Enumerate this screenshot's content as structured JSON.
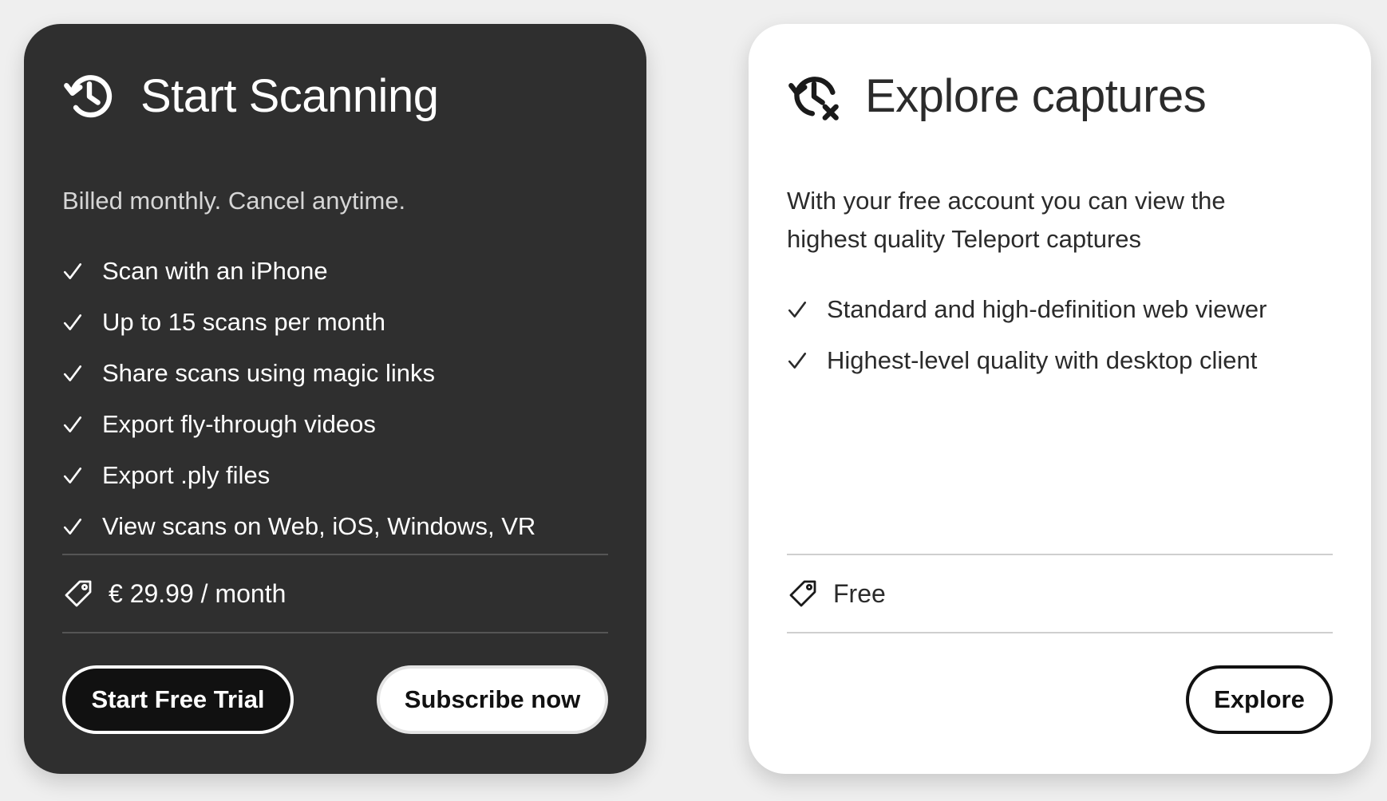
{
  "plans": {
    "paid": {
      "icon": "history-clock-icon",
      "title": "Start Scanning",
      "description": "Billed monthly. Cancel anytime.",
      "features": [
        "Scan with an iPhone",
        "Up to 15 scans per month",
        "Share scans using magic links",
        "Export fly-through videos",
        "Export .ply files",
        "View scans on Web, iOS, Windows, VR"
      ],
      "price": "€ 29.99 / month",
      "buttons": {
        "trial": "Start Free Trial",
        "subscribe": "Subscribe now"
      }
    },
    "free": {
      "icon": "history-clock-cancel-icon",
      "title": "Explore captures",
      "description": "With your free account you can view the highest quality Teleport captures",
      "features": [
        "Standard and high-definition web viewer",
        "Highest-level quality with desktop client"
      ],
      "price": "Free",
      "buttons": {
        "explore": "Explore"
      }
    }
  },
  "colors": {
    "page_background": "#efefef",
    "dark_card": "#2f2f2f",
    "light_card": "#ffffff",
    "primary_button": "#111111"
  }
}
